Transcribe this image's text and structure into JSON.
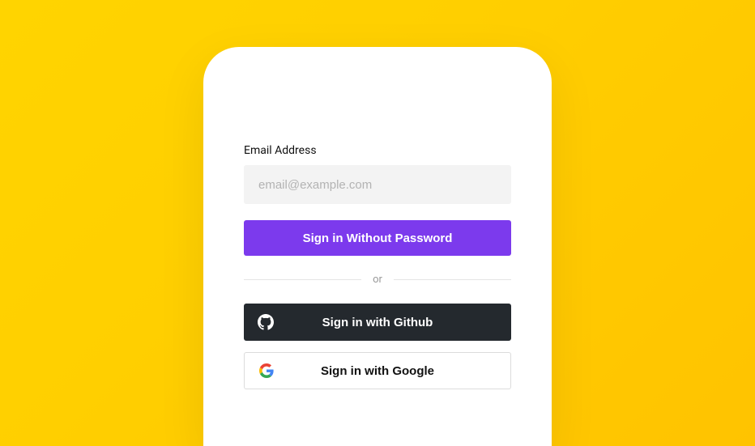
{
  "form": {
    "email_label": "Email Address",
    "email_placeholder": "email@example.com",
    "submit_label": "Sign in Without Password"
  },
  "divider": {
    "text": "or"
  },
  "oauth": {
    "github_label": "Sign in with Github",
    "google_label": "Sign in with Google"
  },
  "colors": {
    "accent": "#7c3aed",
    "github_bg": "#24292e",
    "page_bg_from": "#ffd400",
    "page_bg_to": "#ffc300"
  }
}
